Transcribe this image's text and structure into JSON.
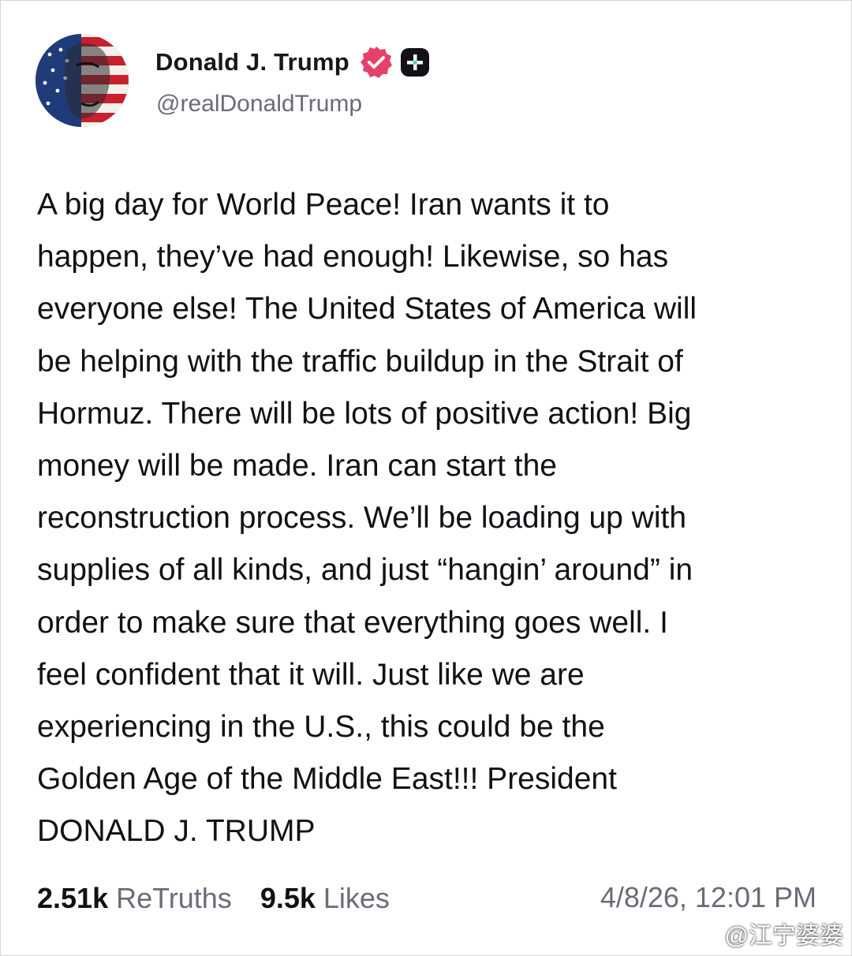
{
  "post": {
    "author": {
      "display_name": "Donald J. Trump",
      "handle": "@realDonaldTrump",
      "avatar_icon": "avatar-flag-portrait-icon",
      "verified_icon": "verified-badge-icon",
      "plus_icon": "plus-badge-icon"
    },
    "text": "A big day for World Peace! Iran wants it to\nhappen, they’ve had enough! Likewise, so has\neveryone else! The United States of America will\nbe helping with the traffic buildup in the Strait of\nHormuz. There will be lots of positive action! Big\nmoney will be made. Iran can start the\nreconstruction process. We’ll be loading up with\nsupplies of all kinds, and just “hangin’ around” in\norder to make sure that everything goes well. I\nfeel confident that it will. Just like we are\nexperiencing in the U.S., this could be the\nGolden Age of the Middle East!!! President\nDONALD J. TRUMP",
    "stats": {
      "retruths_count": "2.51k",
      "retruths_label": "ReTruths",
      "likes_count": "9.5k",
      "likes_label": "Likes"
    },
    "timestamp": "4/8/26, 12:01 PM"
  },
  "watermark": {
    "text": "@江宁婆婆",
    "icon": "weibo-logo-icon"
  },
  "colors": {
    "verified": "#e5416b",
    "plus_badge": "#111116",
    "secondary_text": "#6b6b78",
    "primary_text": "#111116"
  }
}
